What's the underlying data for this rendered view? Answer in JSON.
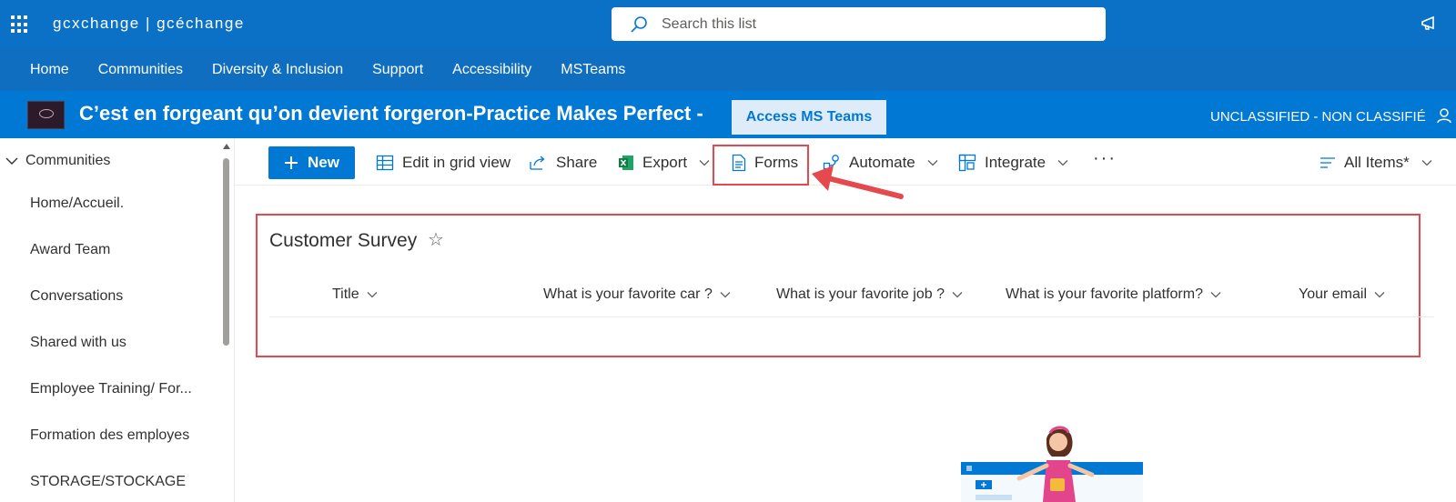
{
  "suite_bar": {
    "brand": "gcxchange | gcéchange",
    "search_placeholder": "Search this list"
  },
  "hub_nav": {
    "items": [
      "Home",
      "Communities",
      "Diversity & Inclusion",
      "Support",
      "Accessibility",
      "MSTeams"
    ]
  },
  "site_header": {
    "title": "C’est en forgeant qu’on devient forgeron-Practice Makes Perfect -",
    "access_button": "Access MS Teams",
    "classification": "UNCLASSIFIED - NON CLASSIFIÉ"
  },
  "left_nav": {
    "header": "Communities",
    "items": [
      "Home/Accueil.",
      "Award Team",
      "Conversations",
      "Shared with us",
      "Employee Training/ For...",
      "Formation des employes",
      "STORAGE/STOCKAGE"
    ]
  },
  "command_bar": {
    "new_label": "New",
    "edit_grid_label": "Edit in grid view",
    "share_label": "Share",
    "export_label": "Export",
    "forms_label": "Forms",
    "automate_label": "Automate",
    "integrate_label": "Integrate",
    "more_label": "···",
    "view_label": "All Items*"
  },
  "list": {
    "title": "Customer Survey",
    "columns": [
      "Title",
      "What is your favorite car ?",
      "What is your favorite job ?",
      "What is your favorite platform?",
      "Your email"
    ]
  },
  "colors": {
    "suite_bar": "#0B71C7",
    "hub_nav": "#0F6EC0",
    "site_header": "#0078D4",
    "highlight": "#E5484D"
  }
}
